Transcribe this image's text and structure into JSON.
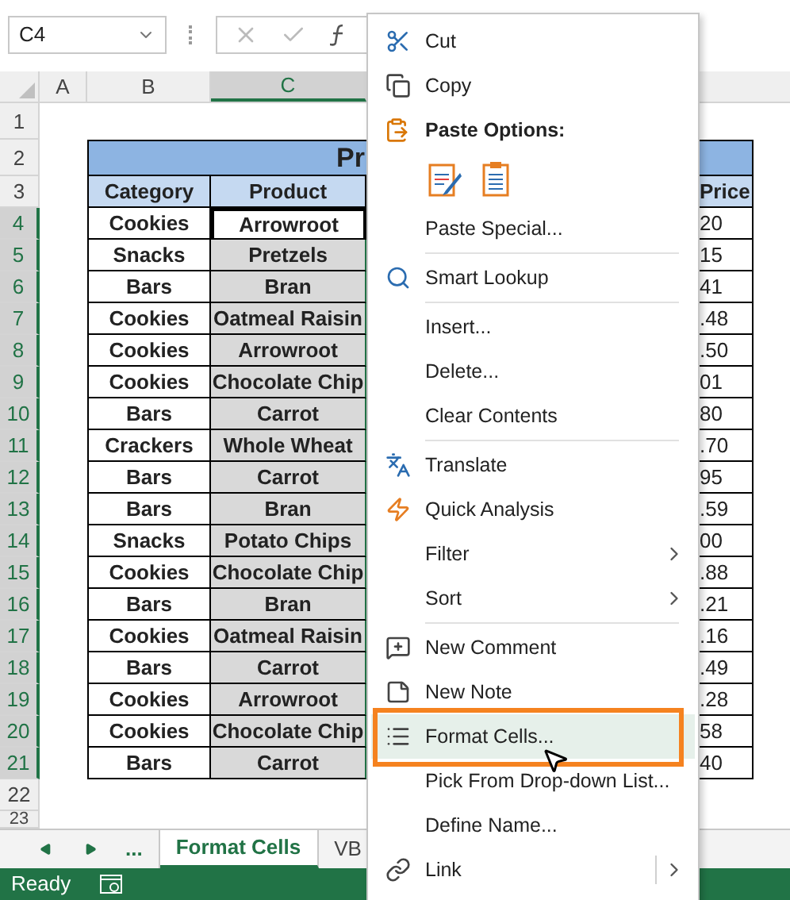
{
  "name_box": {
    "value": "C4"
  },
  "columns": [
    {
      "label": "A",
      "selected": false
    },
    {
      "label": "B",
      "selected": false
    },
    {
      "label": "C",
      "selected": true
    }
  ],
  "title_fragment": "Pr",
  "headers": [
    "Category",
    "Product",
    "Price"
  ],
  "row_numbers": [
    {
      "label": "1",
      "selected": false
    },
    {
      "label": "2",
      "selected": false
    },
    {
      "label": "3",
      "selected": false
    },
    {
      "label": "4",
      "selected": true
    },
    {
      "label": "5",
      "selected": true
    },
    {
      "label": "6",
      "selected": true
    },
    {
      "label": "7",
      "selected": true
    },
    {
      "label": "8",
      "selected": true
    },
    {
      "label": "9",
      "selected": true
    },
    {
      "label": "10",
      "selected": true
    },
    {
      "label": "11",
      "selected": true
    },
    {
      "label": "12",
      "selected": true
    },
    {
      "label": "13",
      "selected": true
    },
    {
      "label": "14",
      "selected": true
    },
    {
      "label": "15",
      "selected": true
    },
    {
      "label": "16",
      "selected": true
    },
    {
      "label": "17",
      "selected": true
    },
    {
      "label": "18",
      "selected": true
    },
    {
      "label": "19",
      "selected": true
    },
    {
      "label": "20",
      "selected": true
    },
    {
      "label": "21",
      "selected": true
    },
    {
      "label": "22",
      "selected": false
    },
    {
      "label": "23",
      "selected": false
    }
  ],
  "rows": [
    {
      "category": "Cookies",
      "product": "Arrowroot",
      "price": "20"
    },
    {
      "category": "Snacks",
      "product": "Pretzels",
      "price": "15"
    },
    {
      "category": "Bars",
      "product": "Bran",
      "price": "41"
    },
    {
      "category": "Cookies",
      "product": "Oatmeal Raisin",
      "price": ".48"
    },
    {
      "category": "Cookies",
      "product": "Arrowroot",
      "price": ".50"
    },
    {
      "category": "Cookies",
      "product": "Chocolate Chip",
      "price": "01"
    },
    {
      "category": "Bars",
      "product": "Carrot",
      "price": "80"
    },
    {
      "category": "Crackers",
      "product": "Whole Wheat",
      "price": ".70"
    },
    {
      "category": "Bars",
      "product": "Carrot",
      "price": "95"
    },
    {
      "category": "Bars",
      "product": "Bran",
      "price": ".59"
    },
    {
      "category": "Snacks",
      "product": "Potato Chips",
      "price": "00"
    },
    {
      "category": "Cookies",
      "product": "Chocolate Chip",
      "price": ".88"
    },
    {
      "category": "Bars",
      "product": "Bran",
      "price": ".21"
    },
    {
      "category": "Cookies",
      "product": "Oatmeal Raisin",
      "price": ".16"
    },
    {
      "category": "Bars",
      "product": "Carrot",
      "price": ".49"
    },
    {
      "category": "Cookies",
      "product": "Arrowroot",
      "price": ".28"
    },
    {
      "category": "Cookies",
      "product": "Chocolate Chip",
      "price": "58"
    },
    {
      "category": "Bars",
      "product": "Carrot",
      "price": "40"
    }
  ],
  "sheet_tabs": {
    "more": "...",
    "tabs": [
      {
        "label": "Format Cells",
        "selected": true
      },
      {
        "label": "VB",
        "selected": false
      }
    ]
  },
  "status_bar": {
    "text": "Ready"
  },
  "context_menu": [
    {
      "kind": "item",
      "label": "Cut",
      "submenu": false,
      "selected": false
    },
    {
      "kind": "item",
      "label": "Copy",
      "submenu": false,
      "selected": false
    },
    {
      "kind": "header",
      "label": "Paste Options:"
    },
    {
      "kind": "paste_icons"
    },
    {
      "kind": "item",
      "label": "Paste Special...",
      "submenu": false,
      "selected": false
    },
    {
      "kind": "divider"
    },
    {
      "kind": "item",
      "label": "Smart Lookup",
      "submenu": false,
      "selected": false
    },
    {
      "kind": "divider"
    },
    {
      "kind": "item",
      "label": "Insert...",
      "submenu": false,
      "selected": false
    },
    {
      "kind": "item",
      "label": "Delete...",
      "submenu": false,
      "selected": false
    },
    {
      "kind": "item",
      "label": "Clear Contents",
      "submenu": false,
      "selected": false
    },
    {
      "kind": "divider"
    },
    {
      "kind": "item",
      "label": "Translate",
      "submenu": false,
      "selected": false
    },
    {
      "kind": "item",
      "label": "Quick Analysis",
      "submenu": false,
      "selected": false
    },
    {
      "kind": "item",
      "label": "Filter",
      "submenu": true,
      "selected": false
    },
    {
      "kind": "item",
      "label": "Sort",
      "submenu": true,
      "selected": false
    },
    {
      "kind": "divider"
    },
    {
      "kind": "item",
      "label": "New Comment",
      "submenu": false,
      "selected": false
    },
    {
      "kind": "item",
      "label": "New Note",
      "submenu": false,
      "selected": false
    },
    {
      "kind": "item",
      "label": "Format Cells...",
      "submenu": false,
      "selected": true
    },
    {
      "kind": "item",
      "label": "Pick From Drop-down List...",
      "submenu": false,
      "selected": false
    },
    {
      "kind": "item",
      "label": "Define Name...",
      "submenu": false,
      "selected": false
    },
    {
      "kind": "item",
      "label": "Link",
      "submenu": true,
      "selected": false
    }
  ]
}
